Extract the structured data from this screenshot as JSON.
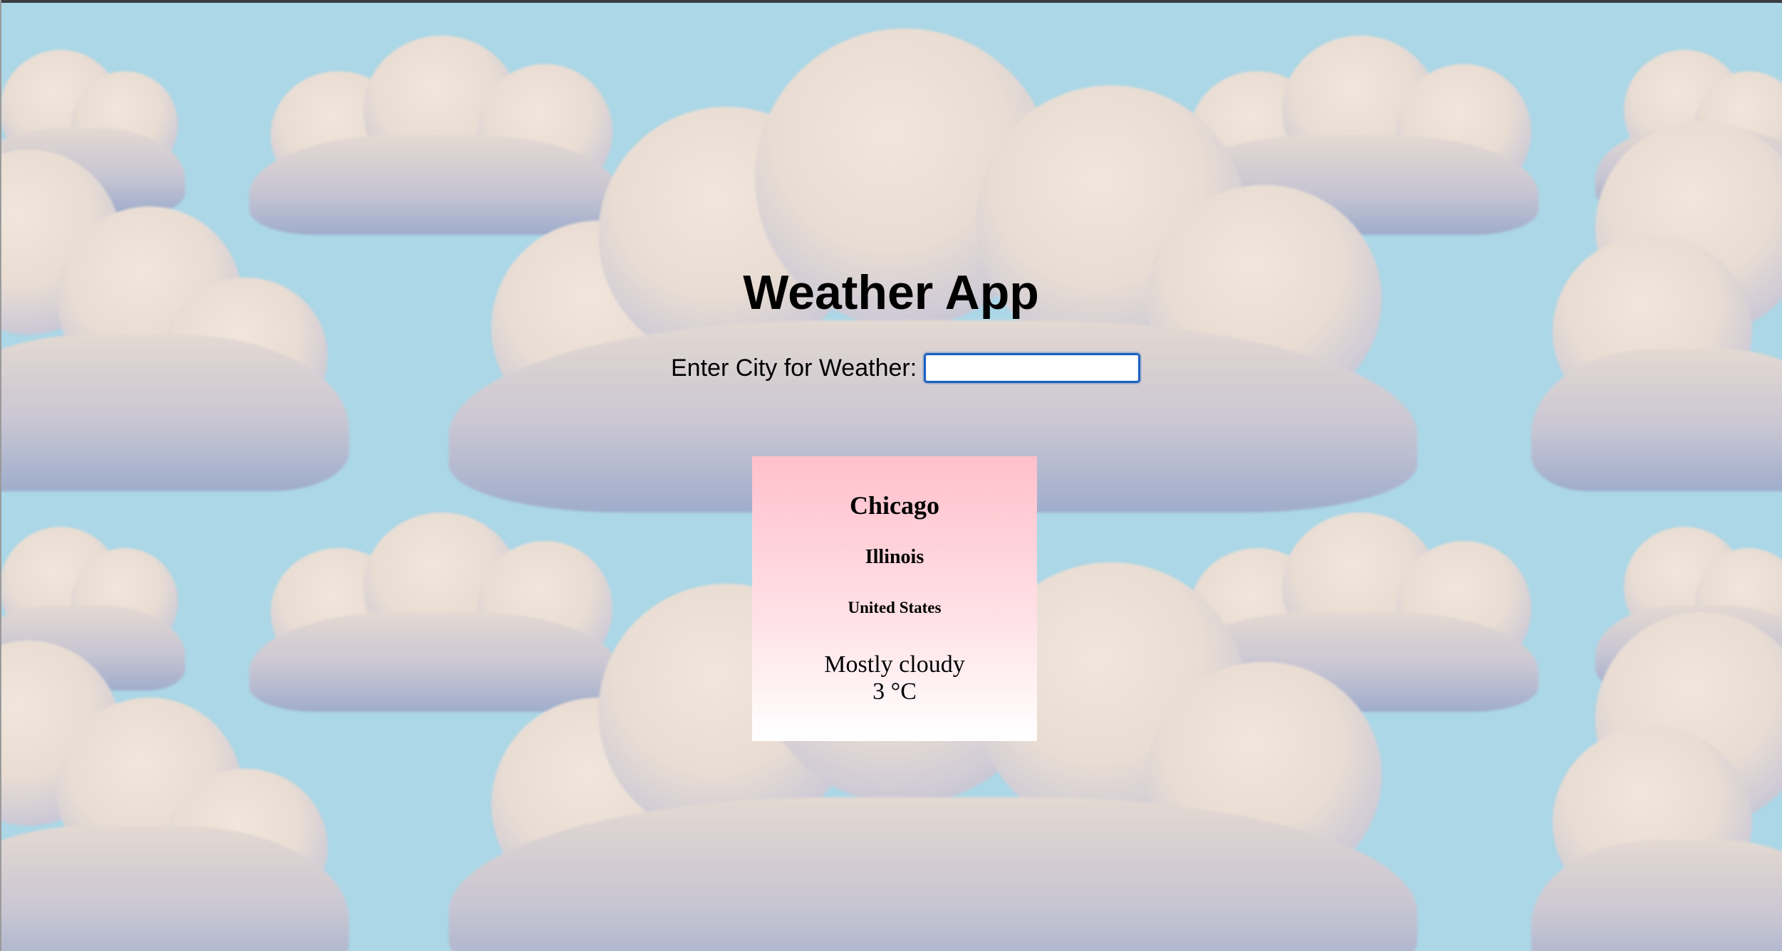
{
  "app": {
    "title": "Weather App"
  },
  "search": {
    "label": "Enter City for Weather:",
    "value": "",
    "placeholder": ""
  },
  "weather_card": {
    "city": "Chicago",
    "region": "Illinois",
    "country": "United States",
    "condition": "Mostly cloudy",
    "temperature": "3 °C"
  },
  "colors": {
    "sky_background": "#acd7e6",
    "card_gradient_top": "#ffc0cb",
    "card_gradient_bottom": "#ffffff",
    "input_focus_border": "#1a5fc1"
  },
  "background": {
    "pattern": "tiled-clouds"
  }
}
